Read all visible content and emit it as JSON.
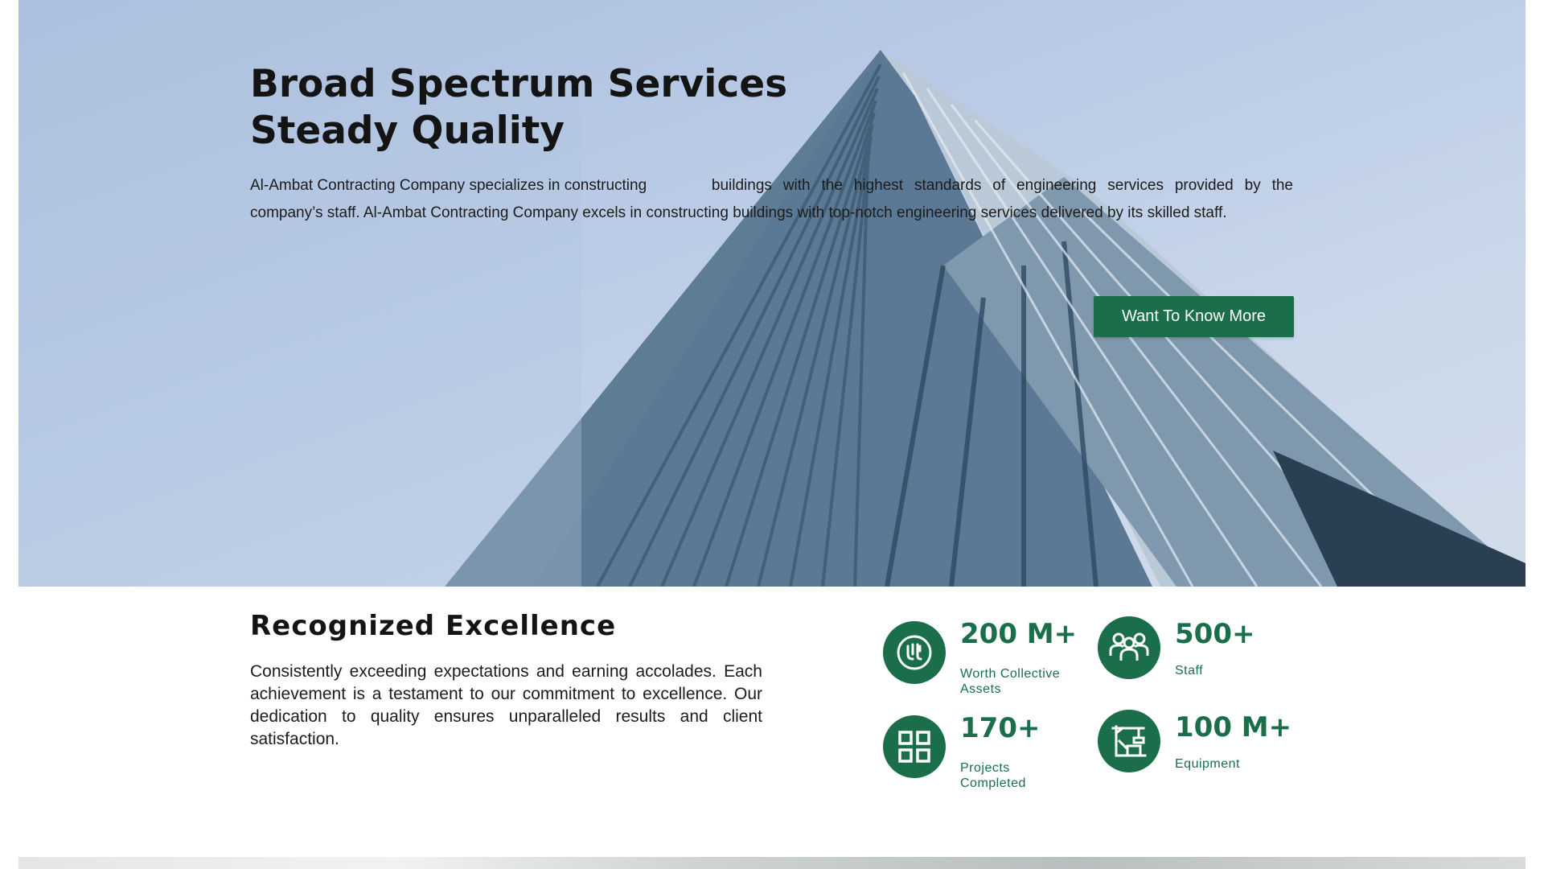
{
  "hero": {
    "title_line1": "Broad Spectrum Services",
    "title_line2": "Steady Quality",
    "description_line1": "Al-Ambat Contracting Company specializes in constructing",
    "description_rest": "buildings with the highest standards of engineering services provided by the company’s staff. Al-Ambat Contracting Company excels in constructing buildings with top-notch engineering services delivered by its skilled staff.",
    "cta_label": "Want To Know More"
  },
  "excellence": {
    "title": "Recognized Excellence",
    "description": "Consistently exceeding expectations and earning accolades. Each achievement is a testament to our commitment to excellence. Our dedication to quality ensures unparalleled results and client satisfaction."
  },
  "stats": [
    {
      "value": "200 M+",
      "label": "Worth Collective Assets",
      "icon": "riyal-coin-icon"
    },
    {
      "value": "500+",
      "label": "Staff",
      "icon": "people-group-icon"
    },
    {
      "value": "170+",
      "label": "Projects Completed",
      "icon": "grid-blocks-icon"
    },
    {
      "value": "100 M+",
      "label": "Equipment",
      "icon": "crane-icon"
    }
  ],
  "colors": {
    "accent": "#1a6e49",
    "text": "#141414",
    "sky": "#bccde6"
  }
}
